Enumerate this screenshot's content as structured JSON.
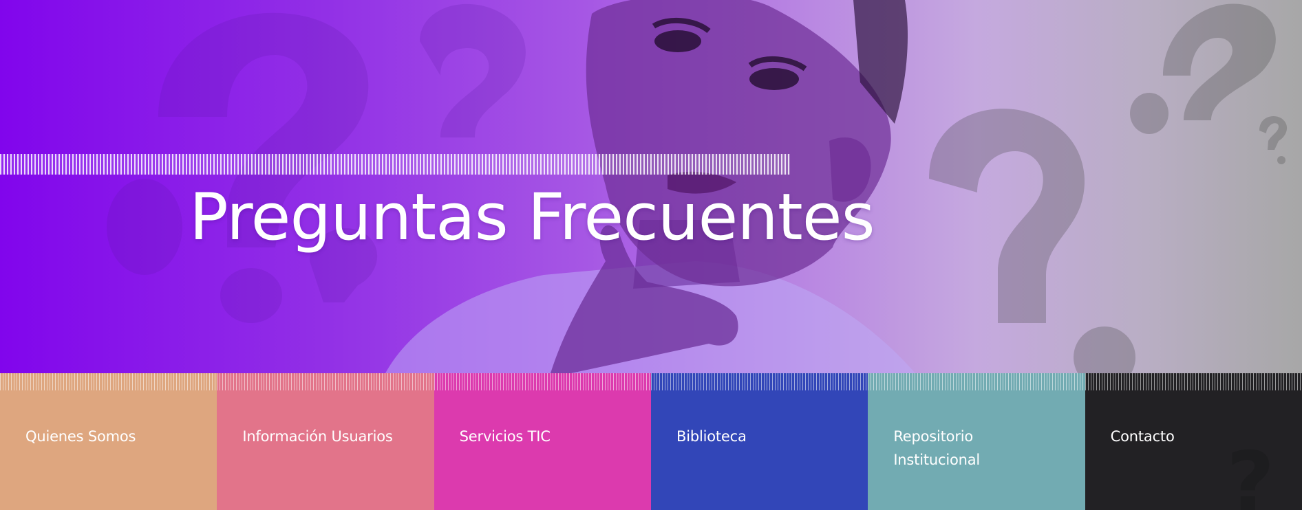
{
  "hero": {
    "title": "Preguntas Frecuentes",
    "image": "thinking-man-with-question-marks-photo",
    "gradient_colors": [
      "#8105ec",
      "#a657e4",
      "#c5a9df",
      "#a7a7a7"
    ]
  },
  "nav": {
    "items": [
      {
        "label": "Quienes Somos",
        "color": "#dea67f"
      },
      {
        "label": "Información Usuarios",
        "color": "#e2748a"
      },
      {
        "label": "Servicios TIC",
        "color": "#dc3aae"
      },
      {
        "label": "Biblioteca",
        "color": "#3246b8"
      },
      {
        "label": "Repositorio Institucional",
        "color": "#72abb2"
      },
      {
        "label": "Contacto",
        "color": "#222124"
      }
    ]
  }
}
